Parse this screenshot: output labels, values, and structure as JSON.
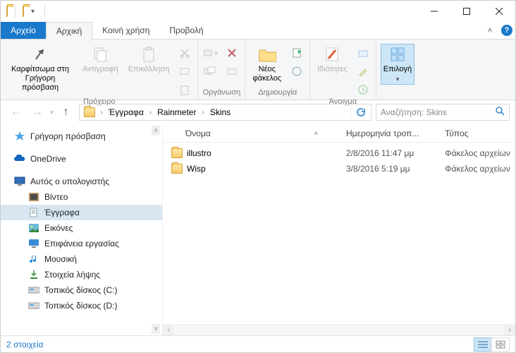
{
  "tabs": {
    "file": "Αρχείο",
    "home": "Αρχική",
    "share": "Κοινή χρήση",
    "view": "Προβολή"
  },
  "ribbon": {
    "pin": "Καρφίτσωμα στη\nΓρήγορη πρόσβαση",
    "copy": "Αντιγραφή",
    "paste": "Επικόλληση",
    "clipboard_group": "Πρόχειρο",
    "organize_group": "Οργάνωση",
    "newfolder": "Νέος\nφάκελος",
    "new_group": "Δημιουργία",
    "properties": "Ιδιότητες",
    "open_group": "Άνοιγμα",
    "select": "Επιλογή"
  },
  "breadcrumbs": [
    "Έγγραφα",
    "Rainmeter",
    "Skins"
  ],
  "search_placeholder": "Αναζήτηση: Skins",
  "nav": {
    "quick": "Γρήγορη πρόσβαση",
    "onedrive": "OneDrive",
    "thispc": "Αυτός ο υπολογιστής",
    "videos": "Βίντεο",
    "documents": "Έγγραφα",
    "pictures": "Εικόνες",
    "desktop": "Επιφάνεια εργασίας",
    "music": "Μουσική",
    "downloads": "Στοιχεία λήψης",
    "diskc": "Τοπικός δίσκος (C:)",
    "diskd": "Τοπικός δίσκος (D:)"
  },
  "columns": {
    "name": "Όνομα",
    "date": "Ημερομηνία τροπ...",
    "type": "Τύπος"
  },
  "files": [
    {
      "name": "illustro",
      "date": "2/8/2016 11:47 μμ",
      "type": "Φάκελος αρχείων"
    },
    {
      "name": "Wisp",
      "date": "3/8/2016 5:19 μμ",
      "type": "Φάκελος αρχείων"
    }
  ],
  "status": "2 στοιχεία"
}
